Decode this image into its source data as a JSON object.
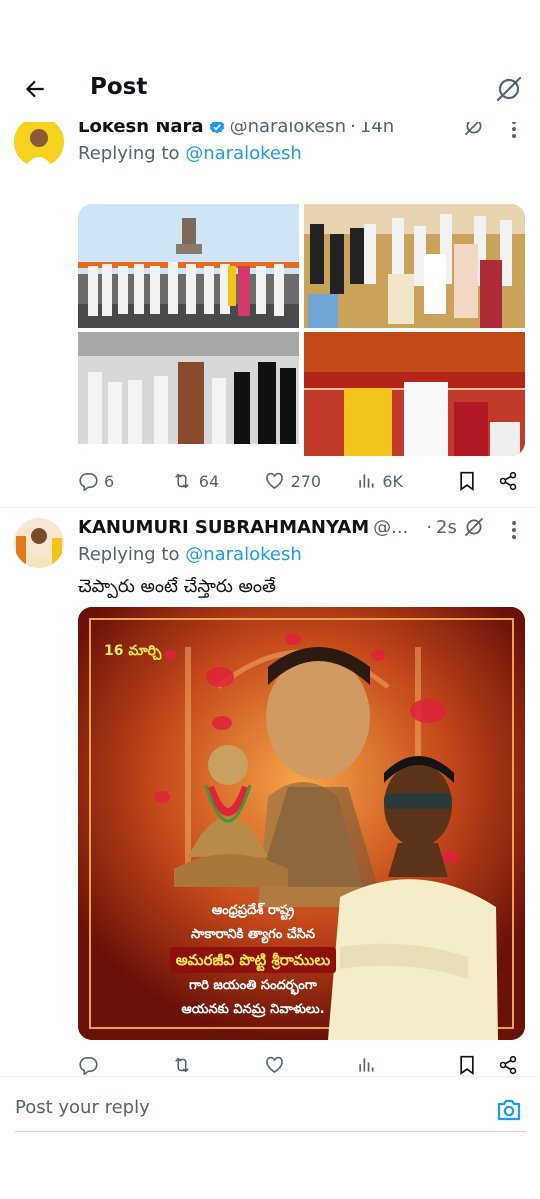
{
  "header": {
    "title": "Post"
  },
  "tweet1": {
    "name": "Lokesh Nara",
    "handle": "@naralokesh",
    "time": "14h",
    "replying_prefix": "Replying to",
    "replying_to": "@naralokesh",
    "stats": {
      "replies": "6",
      "reposts": "64",
      "likes": "270",
      "views": "6K"
    }
  },
  "tweet2": {
    "name": "KANUMURI SUBRAHMANYAM",
    "handle": "@...",
    "time": "2s",
    "replying_prefix": "Replying to",
    "replying_to": "@naralokesh",
    "text": "చెప్పారు అంటే చేస్తారు అంతే",
    "poster": {
      "date": "16 మార్చి",
      "line1": "ఆంధ్రప్రదేశ్ రాష్ట్ర",
      "line2": "సాకారానికి త్యాగం చేసిన",
      "highlight": "అమరజీవి పొట్టి శ్రీరాములు",
      "line3": "గారి జయంతి సందర్భంగా",
      "line4": "ఆయనకు వినమ్ర నివాళులు."
    }
  },
  "reply": {
    "placeholder": "Post your reply"
  },
  "colors": {
    "accent": "#1d9bf0",
    "muted": "#536471",
    "text": "#0f1419",
    "divider": "#eff3f4"
  },
  "icons": [
    "back-arrow-icon",
    "grok-icon",
    "verified-badge-icon",
    "more-icon",
    "reply-icon",
    "repost-icon",
    "like-icon",
    "views-icon",
    "bookmark-icon",
    "share-icon",
    "camera-icon"
  ]
}
